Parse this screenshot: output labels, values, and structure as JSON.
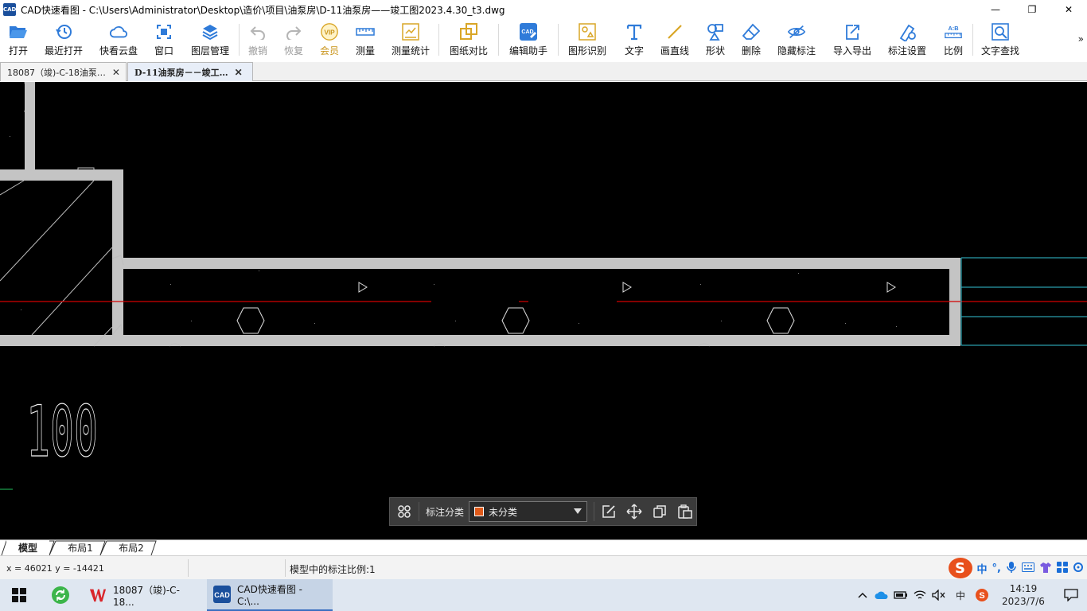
{
  "window": {
    "app_icon_text": "CAD",
    "title": "CAD快速看图 - C:\\Users\\Administrator\\Desktop\\造价\\项目\\油泵房\\D-11油泵房——竣工图2023.4.30_t3.dwg",
    "minimize": "—",
    "maximize": "❐",
    "close": "✕"
  },
  "toolbar": {
    "items": [
      {
        "id": "open",
        "label": "打开",
        "icon": "folder-open-icon"
      },
      {
        "id": "recent",
        "label": "最近打开",
        "icon": "clock-history-icon"
      },
      {
        "id": "cloud",
        "label": "快看云盘",
        "icon": "cloud-icon"
      },
      {
        "id": "window",
        "label": "窗口",
        "icon": "window-frame-icon"
      },
      {
        "id": "layers",
        "label": "图层管理",
        "icon": "layers-icon"
      },
      {
        "id": "undo",
        "label": "撤销",
        "icon": "undo-icon"
      },
      {
        "id": "redo",
        "label": "恢复",
        "icon": "redo-icon"
      },
      {
        "id": "vip",
        "label": "会员",
        "icon": "vip-badge-icon"
      },
      {
        "id": "measure",
        "label": "测量",
        "icon": "ruler-icon"
      },
      {
        "id": "measure_stats",
        "label": "测量统计",
        "icon": "measure-stats-icon"
      },
      {
        "id": "compare",
        "label": "图纸对比",
        "icon": "compare-icon"
      },
      {
        "id": "edit_helper",
        "label": "编辑助手",
        "icon": "edit-helper-icon"
      },
      {
        "id": "shape_recog",
        "label": "图形识别",
        "icon": "shape-recognition-icon"
      },
      {
        "id": "text",
        "label": "文字",
        "icon": "text-t-icon"
      },
      {
        "id": "line",
        "label": "画直线",
        "icon": "line-icon"
      },
      {
        "id": "shape",
        "label": "形状",
        "icon": "shapes-icon"
      },
      {
        "id": "delete",
        "label": "删除",
        "icon": "eraser-icon"
      },
      {
        "id": "hide",
        "label": "隐藏标注",
        "icon": "eye-hidden-icon"
      },
      {
        "id": "import_export",
        "label": "导入导出",
        "icon": "export-icon"
      },
      {
        "id": "anno_settings",
        "label": "标注设置",
        "icon": "annotation-settings-icon"
      },
      {
        "id": "scale",
        "label": "比例",
        "icon": "scale-ratio-icon"
      },
      {
        "id": "text_search",
        "label": "文字查找",
        "icon": "text-search-icon"
      }
    ],
    "scale_icon_text": "A:B",
    "more": "»"
  },
  "tabs": [
    {
      "label": "18087（竣)-C-18油泵…",
      "active": false
    },
    {
      "label": "D-11油泵房－－竣工…",
      "active": true
    }
  ],
  "tab_close": "✕",
  "drawing": {
    "dimension_text": "100"
  },
  "annotation_panel": {
    "label": "标注分类",
    "selected": "未分类",
    "swatch_color": "#e05a1a"
  },
  "layout_tabs": [
    {
      "label": "模型",
      "active": true
    },
    {
      "label": "布局1",
      "active": false
    },
    {
      "label": "布局2",
      "active": false
    }
  ],
  "status": {
    "coords": "x = 46021  y = -14421",
    "scale_text": "模型中的标注比例:1"
  },
  "ime": {
    "logo": "S",
    "items": [
      "中",
      "°,"
    ]
  },
  "taskbar": {
    "apps": [
      {
        "label": "18087（竣)-C-18...",
        "icon": "wps-icon",
        "active": false
      },
      {
        "label": "CAD快速看图 - C:\\...",
        "icon": "cad-viewer-icon",
        "active": true
      }
    ],
    "tray_lang": "中",
    "time": "14:19",
    "date": "2023/7/6"
  }
}
